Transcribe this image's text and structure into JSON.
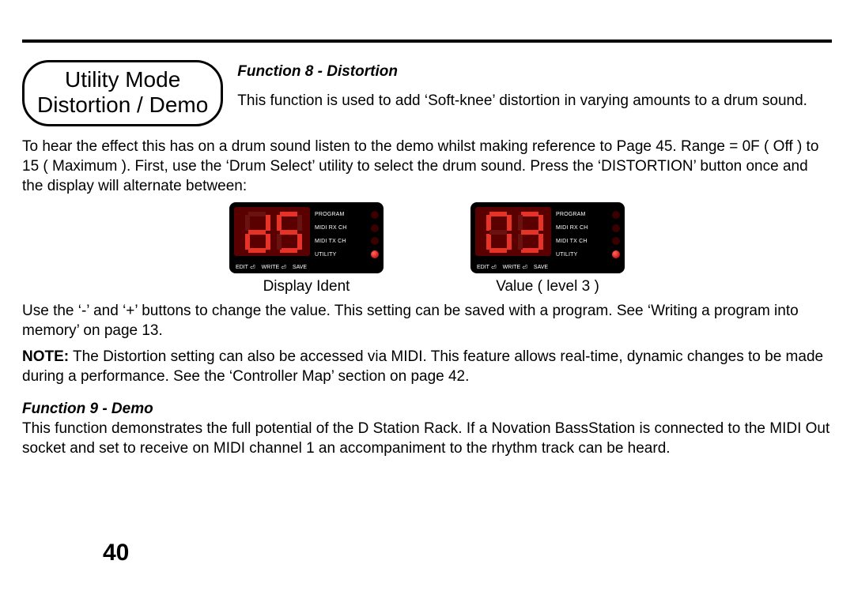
{
  "section": {
    "title_line1": "Utility Mode",
    "title_line2": "Distortion / Demo"
  },
  "func8": {
    "title": "Function 8 - Distortion",
    "intro": "This function is used to add ‘Soft-knee’ distortion in varying amounts to a drum sound.",
    "para1": "To hear the effect this has on a drum sound listen to the demo whilst making reference to Page 45. Range = 0F ( Off ) to 15 ( Maximum ). First, use the ‘Drum Select’ utility to select the drum sound. Press the ‘DISTORTION’ button once and the display will alternate between:",
    "para2": "Use the ‘-’ and ‘+’ buttons to change the value. This setting can be saved with a program. See ‘Writing a program into memory’ on page 13.",
    "note_label": "NOTE:",
    "note": " The Distortion setting can also be accessed via MIDI. This feature allows real-time, dynamic changes to be made during a performance. See the ‘Controller Map’ section on page 42."
  },
  "displays": {
    "led_labels": [
      "PROGRAM",
      "MIDI RX CH",
      "MIDI TX CH",
      "UTILITY"
    ],
    "bottom_labels": [
      "EDIT",
      "WRITE",
      "SAVE"
    ],
    "left": {
      "caption": "Display Ident",
      "digits": "dS",
      "lit_index": 3
    },
    "right": {
      "caption": "Value ( level 3 )",
      "digits": "03",
      "lit_index": 3
    }
  },
  "func9": {
    "title": "Function 9 - Demo",
    "para": "This function demonstrates the full potential of the D Station Rack. If a Novation BassStation is connected to the MIDI Out socket and set to receive on MIDI channel 1 an accompaniment to the rhythm track can be heard."
  },
  "page_number": "40"
}
